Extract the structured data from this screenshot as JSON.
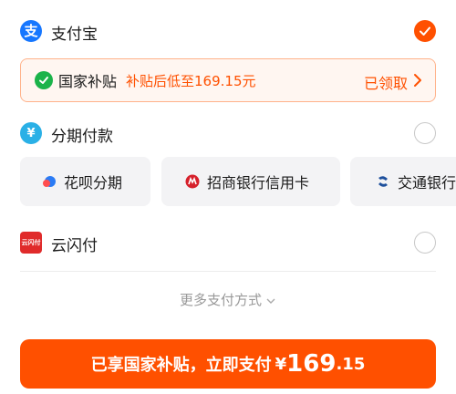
{
  "payment_methods": {
    "alipay": {
      "label": "支付宝",
      "icon": "alipay-icon",
      "selected": true
    },
    "installment": {
      "label": "分期付款",
      "icon": "installment-icon",
      "selected": false
    },
    "unionpay": {
      "label": "云闪付",
      "icon": "unionpay-icon",
      "icon_text": "云闪付",
      "selected": false
    }
  },
  "subsidy": {
    "title": "国家补贴",
    "text": "补贴后低至169.15元",
    "status": "已领取"
  },
  "installment_options": [
    {
      "label": "花呗分期",
      "icon": "huabei-icon"
    },
    {
      "label": "招商银行信用卡",
      "icon": "cmb-icon"
    },
    {
      "label": "交通银行",
      "icon": "bocom-icon"
    }
  ],
  "more_methods": "更多支付方式",
  "pay_button": {
    "text": "已享国家补贴，立即支付",
    "currency": "¥",
    "amount_int": "169",
    "amount_dec": ".15"
  },
  "colors": {
    "accent": "#ff5000",
    "alipay_blue": "#1677ff",
    "subsidy_border": "#ffb28a",
    "subsidy_bg": "#fff6f1"
  }
}
